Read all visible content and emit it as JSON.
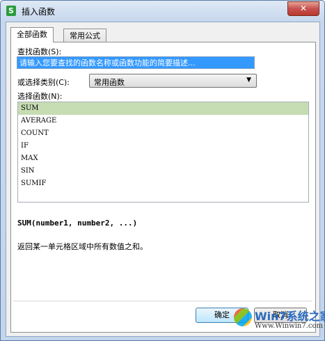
{
  "window": {
    "title": "插入函数",
    "app_icon_letter": "S",
    "close_glyph": "✕"
  },
  "tabs": [
    {
      "label": "全部函数",
      "active": true
    },
    {
      "label": "常用公式",
      "active": false
    }
  ],
  "search": {
    "label": "查找函数(S):",
    "value": "请输入您要查找的函数名称或函数功能的简要描述..."
  },
  "category": {
    "label": "或选择类别(C):",
    "selected": "常用函数"
  },
  "functions": {
    "label": "选择函数(N):",
    "items": [
      "SUM",
      "AVERAGE",
      "COUNT",
      "IF",
      "MAX",
      "SIN",
      "SUMIF"
    ],
    "selected_index": 0
  },
  "details": {
    "signature": "SUM(number1, number2, ...)",
    "description": "返回某一单元格区域中所有数值之和。"
  },
  "buttons": {
    "ok": "确定",
    "cancel": "取消"
  },
  "watermark": {
    "brand": "Win7系统之家",
    "url": "Www.Winwin7.com"
  },
  "colors": {
    "selection": "#3399ff",
    "list_selected": "#c6dcb2",
    "app_icon": "#2b9b3e"
  }
}
